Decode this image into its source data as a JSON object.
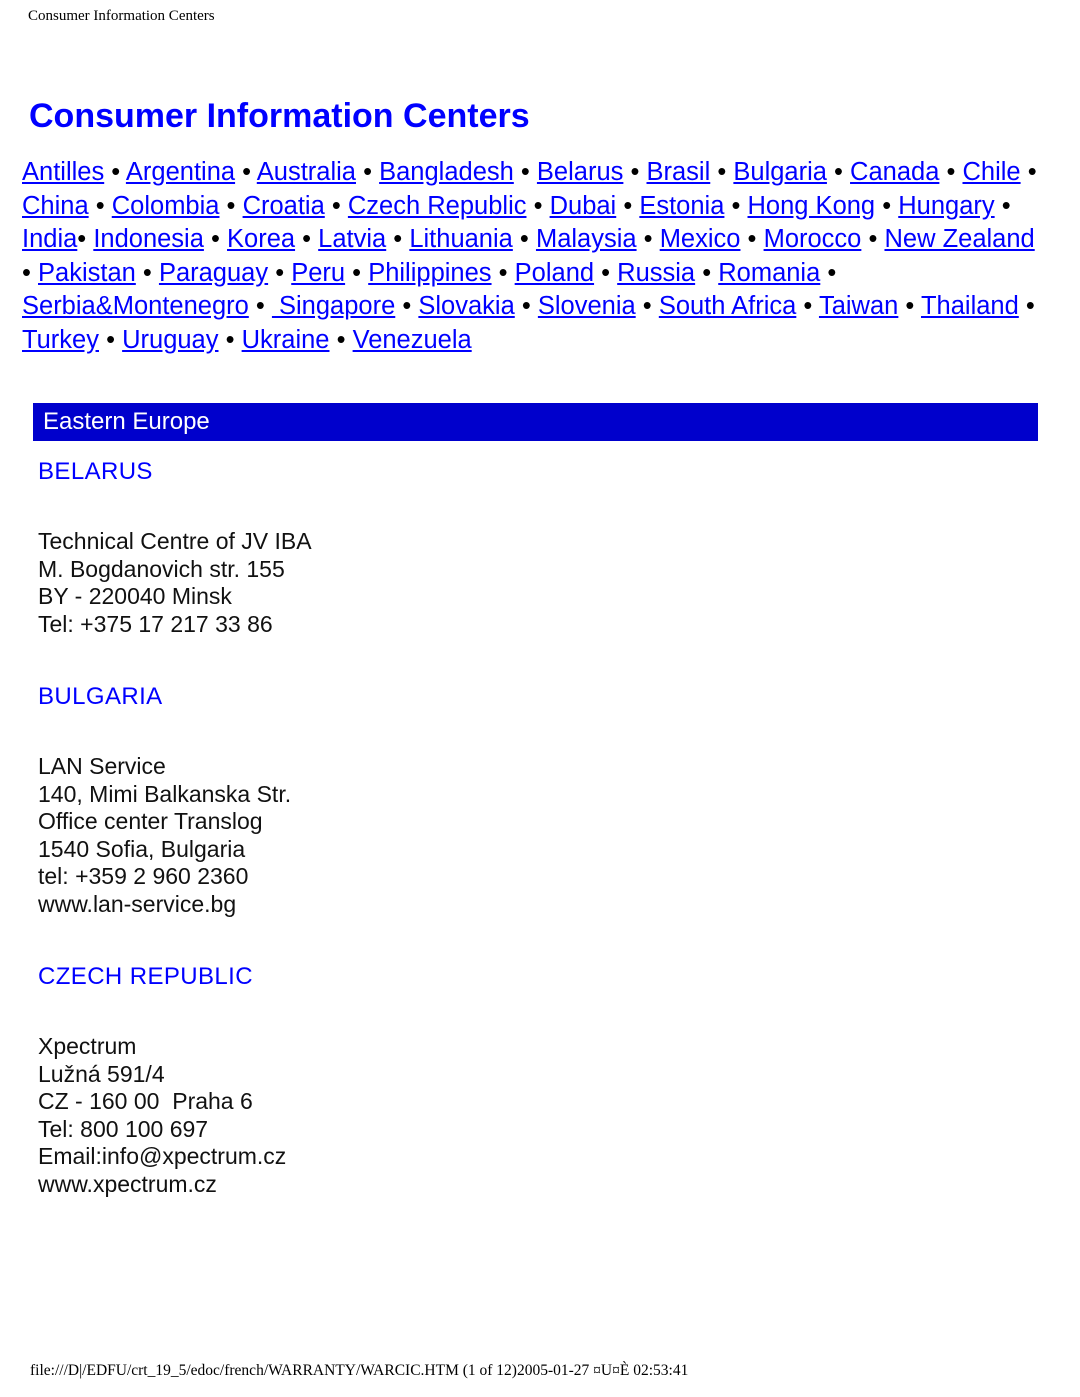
{
  "header": {
    "running_title": "Consumer Information Centers"
  },
  "title": "Consumer Information Centers",
  "index": {
    "separator": "•",
    "links": [
      "Antilles",
      "Argentina",
      "Australia",
      "Bangladesh",
      "Belarus",
      "Brasil",
      "Bulgaria",
      "Canada",
      "Chile",
      "China",
      "Colombia",
      "Croatia",
      "Czech Republic",
      "Dubai",
      "Estonia",
      "Hong Kong",
      "Hungary",
      "India",
      "Indonesia",
      "Korea",
      "Latvia",
      "Lithuania",
      "Malaysia",
      "Mexico",
      "Morocco",
      "New Zealand",
      "Pakistan",
      "Paraguay",
      "Peru",
      "Philippines",
      "Poland",
      "Russia",
      "Romania",
      "Serbia&Montenegro",
      "Singapore",
      "Slovakia",
      "Slovenia",
      "South Africa",
      "Taiwan",
      "Thailand",
      "Turkey",
      "Uruguay",
      "Ukraine",
      "Venezuela"
    ]
  },
  "region": {
    "label": "Eastern Europe",
    "bar_color": "#0000cc",
    "bar_text_color": "#ffffff"
  },
  "countries": [
    {
      "name": "BELARUS",
      "address": [
        "Technical Centre of JV IBA",
        "M. Bogdanovich str. 155",
        "BY - 220040 Minsk",
        "Tel: +375 17 217 33 86"
      ]
    },
    {
      "name": "BULGARIA",
      "address": [
        "LAN Service",
        "140, Mimi Balkanska Str.",
        "Office center Translog",
        "1540 Sofia, Bulgaria",
        "tel: +359 2 960 2360",
        "www.lan-service.bg"
      ]
    },
    {
      "name": "CZECH REPUBLIC",
      "address": [
        "Xpectrum",
        "Lužná 591/4",
        "CZ - 160 00  Praha 6",
        "Tel: 800 100 697",
        "Email:info@xpectrum.cz",
        "www.xpectrum.cz"
      ]
    }
  ],
  "footer": {
    "text": "file:///D|/EDFU/crt_19_5/edoc/french/WARRANTY/WARCIC.HTM (1 of 12)2005-01-27 ¤U¤È 02:53:41"
  },
  "colors": {
    "link": "#0000ff",
    "title": "#0000ff",
    "banner": "#0000cc",
    "body_text": "#111111"
  }
}
